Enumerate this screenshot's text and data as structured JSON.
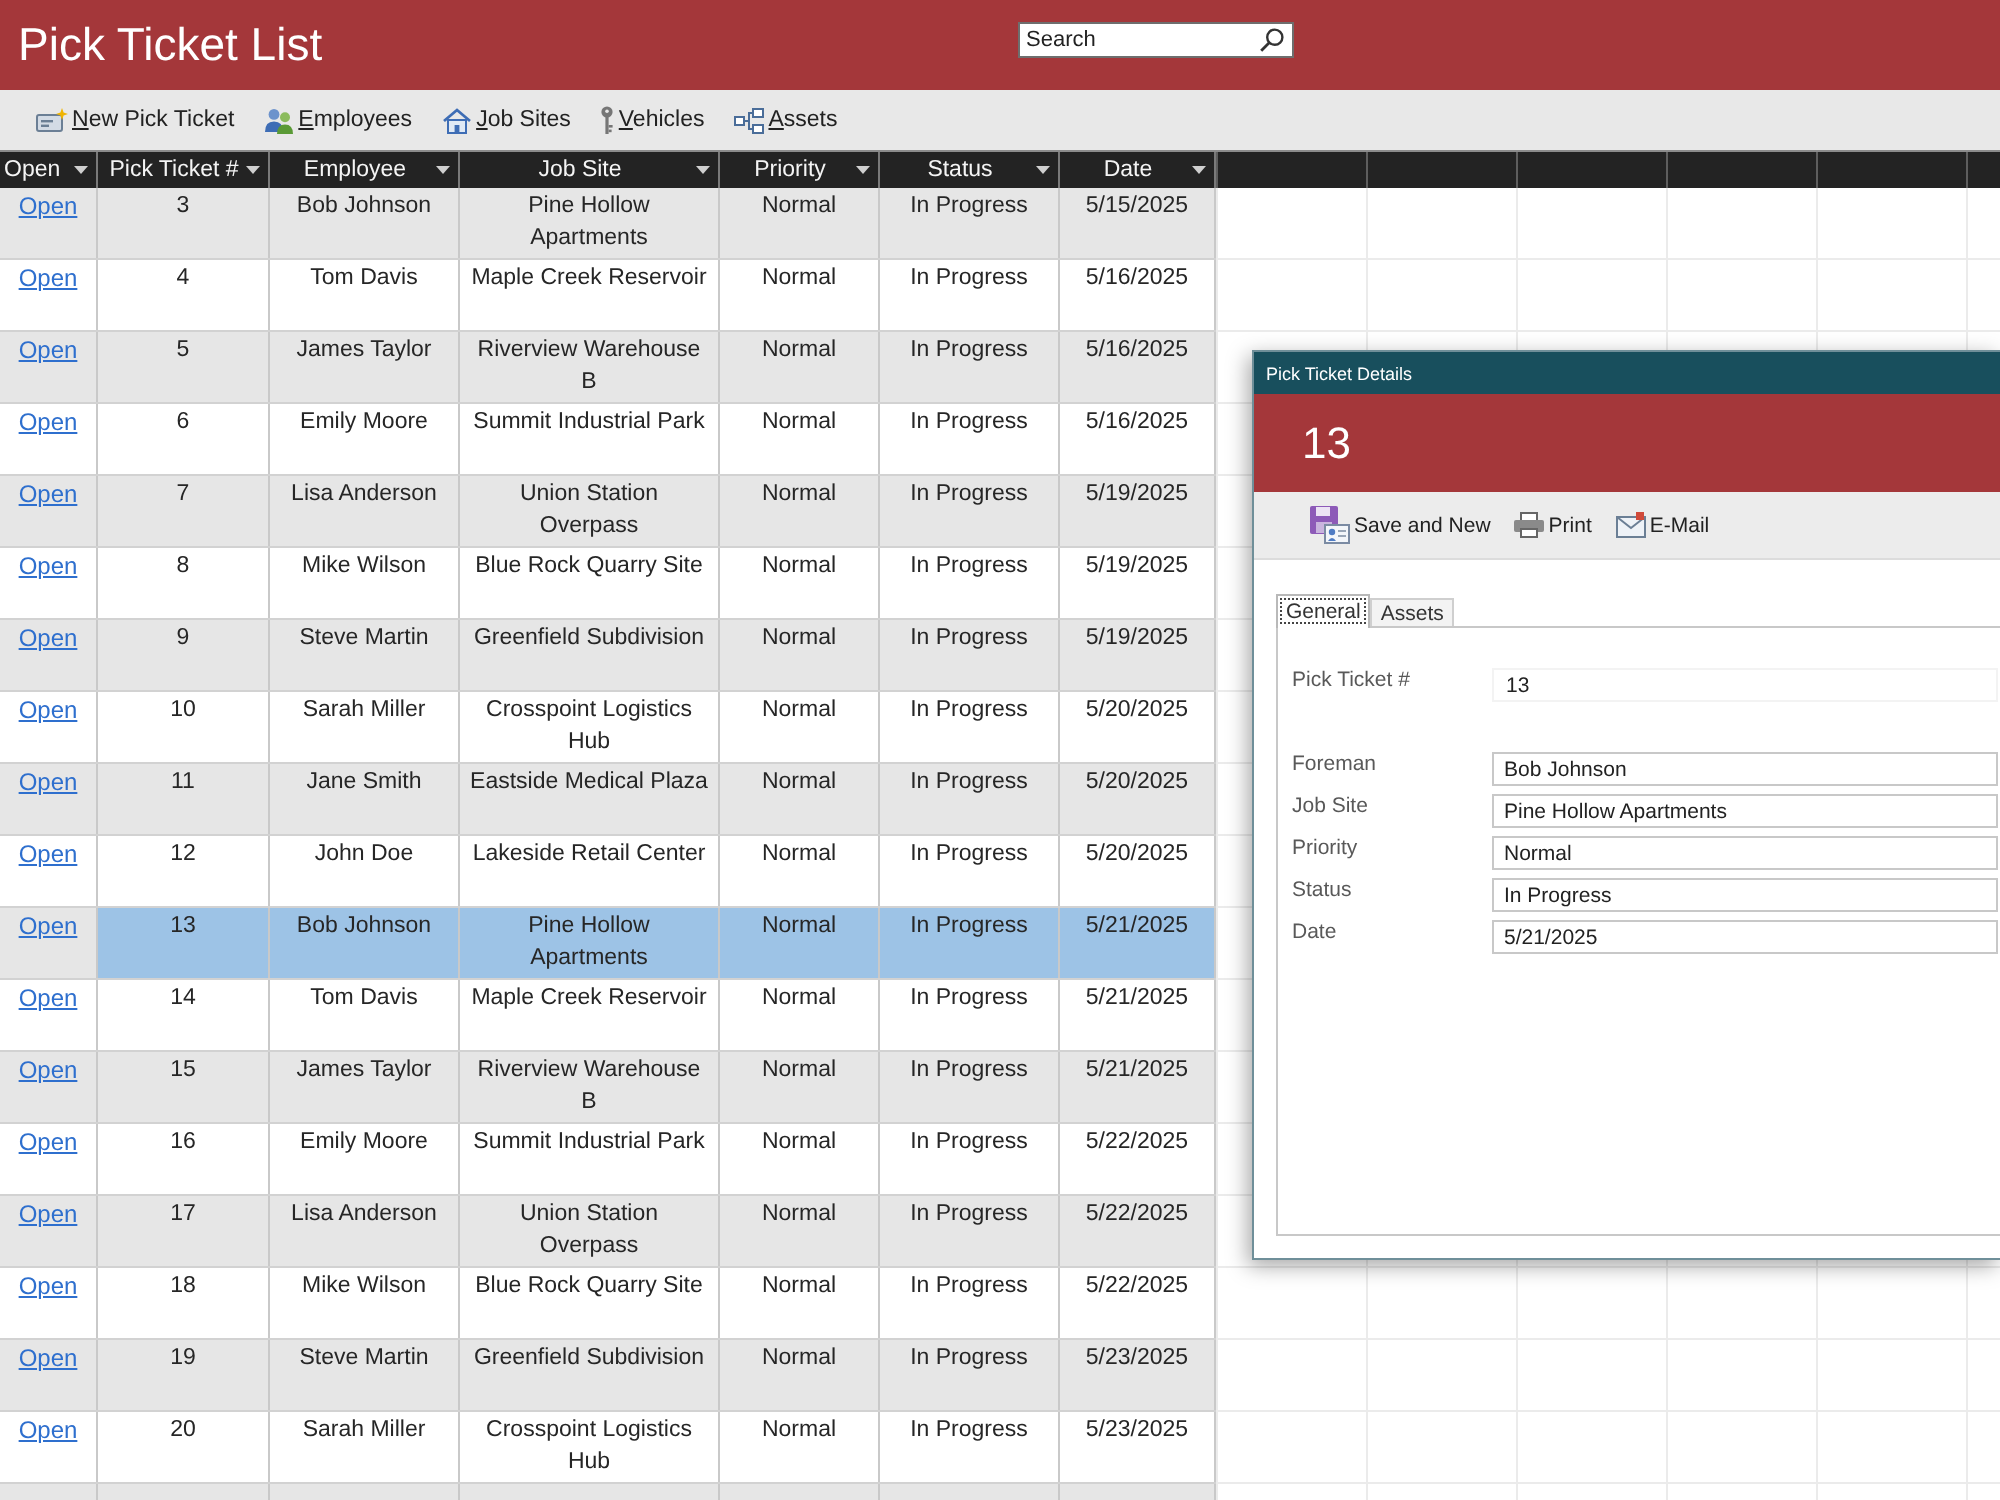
{
  "header": {
    "title": "Pick Ticket List",
    "search": {
      "placeholder": "Search"
    }
  },
  "toolbar": [
    {
      "label": "New Pick Ticket",
      "kind": "new_ticket"
    },
    {
      "label": "Employees",
      "kind": "employees"
    },
    {
      "label": "Job Sites",
      "kind": "job_sites"
    },
    {
      "label": "Vehicles",
      "kind": "vehicles"
    },
    {
      "label": "Assets",
      "kind": "assets"
    }
  ],
  "table": {
    "columns": [
      {
        "label": "Open",
        "kind": "link"
      },
      {
        "label": "Pick Ticket #",
        "kind": "text"
      },
      {
        "label": "Employee",
        "kind": "text"
      },
      {
        "label": "Job Site",
        "kind": "text"
      },
      {
        "label": "Priority",
        "kind": "text"
      },
      {
        "label": "Status",
        "kind": "text"
      },
      {
        "label": "Date",
        "kind": "text"
      }
    ],
    "rows": [
      {
        "cells": [
          "Open",
          "3",
          "Bob Johnson",
          "Pine Hollow Apartments",
          "Normal",
          "In Progress",
          "5/15/2025"
        ],
        "selected": false
      },
      {
        "cells": [
          "Open",
          "4",
          "Tom Davis",
          "Maple Creek Reservoir",
          "Normal",
          "In Progress",
          "5/16/2025"
        ],
        "selected": false
      },
      {
        "cells": [
          "Open",
          "5",
          "James Taylor",
          "Riverview Warehouse B",
          "Normal",
          "In Progress",
          "5/16/2025"
        ],
        "selected": false
      },
      {
        "cells": [
          "Open",
          "6",
          "Emily Moore",
          "Summit Industrial Park",
          "Normal",
          "In Progress",
          "5/16/2025"
        ],
        "selected": false
      },
      {
        "cells": [
          "Open",
          "7",
          "Lisa Anderson",
          "Union Station Overpass",
          "Normal",
          "In Progress",
          "5/19/2025"
        ],
        "selected": false
      },
      {
        "cells": [
          "Open",
          "8",
          "Mike Wilson",
          "Blue Rock Quarry Site",
          "Normal",
          "In Progress",
          "5/19/2025"
        ],
        "selected": false
      },
      {
        "cells": [
          "Open",
          "9",
          "Steve Martin",
          "Greenfield Subdivision",
          "Normal",
          "In Progress",
          "5/19/2025"
        ],
        "selected": false
      },
      {
        "cells": [
          "Open",
          "10",
          "Sarah Miller",
          "Crosspoint Logistics Hub",
          "Normal",
          "In Progress",
          "5/20/2025"
        ],
        "selected": false
      },
      {
        "cells": [
          "Open",
          "11",
          "Jane Smith",
          "Eastside Medical Plaza",
          "Normal",
          "In Progress",
          "5/20/2025"
        ],
        "selected": false
      },
      {
        "cells": [
          "Open",
          "12",
          "John Doe",
          "Lakeside Retail Center",
          "Normal",
          "In Progress",
          "5/20/2025"
        ],
        "selected": false
      },
      {
        "cells": [
          "Open",
          "13",
          "Bob Johnson",
          "Pine Hollow Apartments",
          "Normal",
          "In Progress",
          "5/21/2025"
        ],
        "selected": true
      },
      {
        "cells": [
          "Open",
          "14",
          "Tom Davis",
          "Maple Creek Reservoir",
          "Normal",
          "In Progress",
          "5/21/2025"
        ],
        "selected": false
      },
      {
        "cells": [
          "Open",
          "15",
          "James Taylor",
          "Riverview Warehouse B",
          "Normal",
          "In Progress",
          "5/21/2025"
        ],
        "selected": false
      },
      {
        "cells": [
          "Open",
          "16",
          "Emily Moore",
          "Summit Industrial Park",
          "Normal",
          "In Progress",
          "5/22/2025"
        ],
        "selected": false
      },
      {
        "cells": [
          "Open",
          "17",
          "Lisa Anderson",
          "Union Station Overpass",
          "Normal",
          "In Progress",
          "5/22/2025"
        ],
        "selected": false
      },
      {
        "cells": [
          "Open",
          "18",
          "Mike Wilson",
          "Blue Rock Quarry Site",
          "Normal",
          "In Progress",
          "5/22/2025"
        ],
        "selected": false
      },
      {
        "cells": [
          "Open",
          "19",
          "Steve Martin",
          "Greenfield Subdivision",
          "Normal",
          "In Progress",
          "5/23/2025"
        ],
        "selected": false
      },
      {
        "cells": [
          "Open",
          "20",
          "Sarah Miller",
          "Crosspoint Logistics Hub",
          "Normal",
          "In Progress",
          "5/23/2025"
        ],
        "selected": false
      },
      {
        "selected": false
      }
    ]
  },
  "detail_window": {
    "title": "Pick Ticket Details",
    "heading": "13",
    "toolbar": [
      {
        "label": "Save and New",
        "kind": "save_new"
      },
      {
        "label": "Print",
        "kind": "print"
      },
      {
        "label": "E-Mail",
        "kind": "email"
      }
    ],
    "tabs": [
      {
        "label": "General",
        "selected": true
      },
      {
        "label": "Assets",
        "selected": false
      }
    ],
    "fields": [
      {
        "label": "Pick Ticket #",
        "value": "13",
        "kind": "readonly"
      },
      {
        "label": "Foreman",
        "value": "Bob Johnson",
        "kind": "text"
      },
      {
        "label": "Job Site",
        "value": "Pine Hollow Apartments",
        "kind": "text"
      },
      {
        "label": "Priority",
        "value": "Normal",
        "kind": "text"
      },
      {
        "label": "Status",
        "value": "In Progress",
        "kind": "text"
      },
      {
        "label": "Date",
        "value": "5/21/2025",
        "kind": "text"
      }
    ]
  }
}
